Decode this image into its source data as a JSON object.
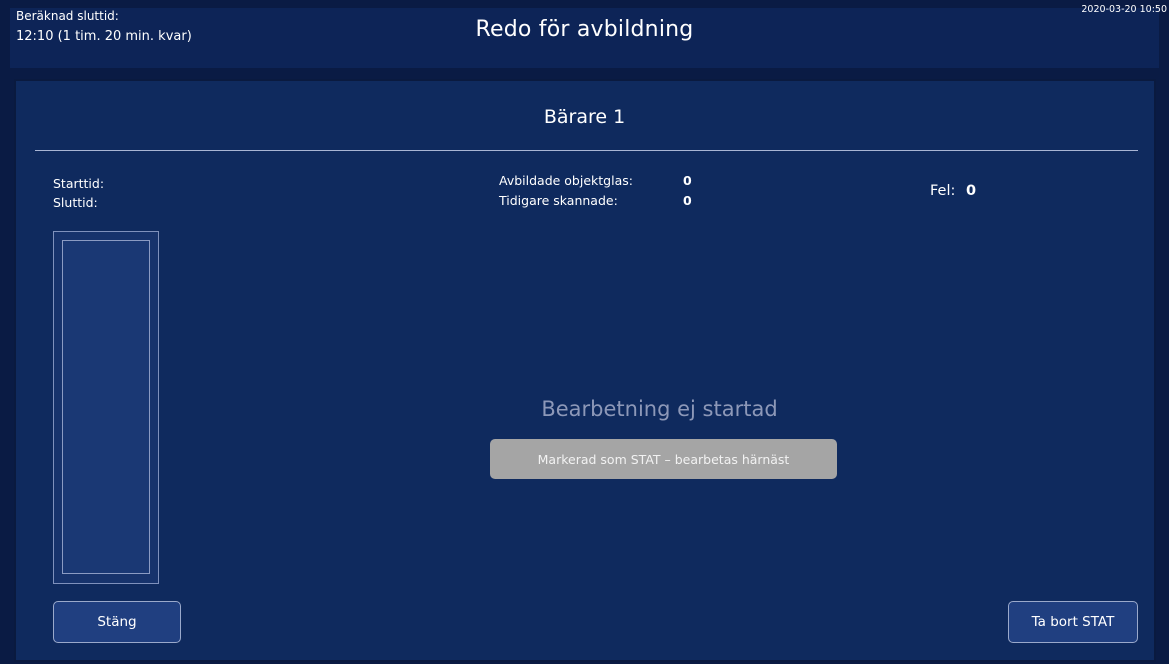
{
  "header": {
    "estimated_end_label": "Beräknad sluttid:",
    "estimated_end_value": "12:10 (1 tim. 20 min. kvar)",
    "title": "Redo för avbildning",
    "datetime": "2020-03-20 10:50"
  },
  "panel": {
    "title": "Bärare 1",
    "start_label": "Starttid:",
    "end_label": "Sluttid:",
    "imaged_label": "Avbildade objektglas:",
    "imaged_value": "0",
    "prev_scanned_label": "Tidigare skannade:",
    "prev_scanned_value": "0",
    "error_label": "Fel:",
    "error_value": "0",
    "status_text": "Bearbetning ej startad",
    "stat_badge": "Markerad som STAT – bearbetas härnäst"
  },
  "buttons": {
    "close_label": "Stäng",
    "remove_stat_label": "Ta bort STAT"
  },
  "colors": {
    "background": "#0a1b44",
    "panel": "#0f2a5e",
    "button": "#203f80",
    "badge": "#a5a5a5",
    "status_text": "#8d98b8"
  }
}
